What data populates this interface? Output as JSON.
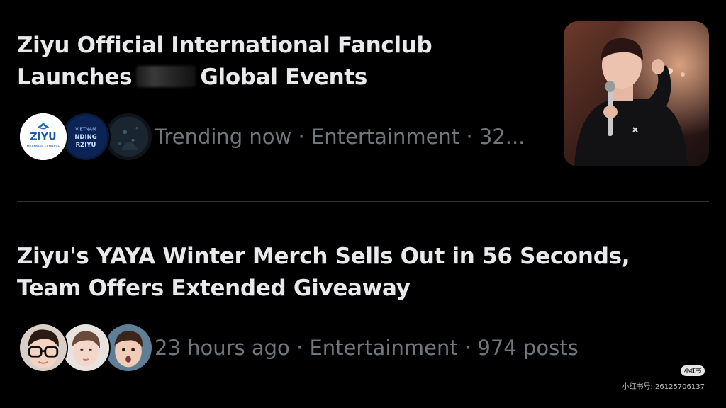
{
  "trends": [
    {
      "headline_part1": "Ziyu Official International Fanclub Launches",
      "headline_part2": "Global Events",
      "meta": "Trending now · Entertainment · 32...",
      "avatars": [
        {
          "icon": "ziyu-myanmar-fanbase-logo",
          "text": "ZIYU",
          "subtext": "MYANMAR FANBASE"
        },
        {
          "icon": "vietnam-fanbase-logo",
          "text": "VIETNAM"
        },
        {
          "icon": "dark-blue-avatar"
        }
      ],
      "thumbnail": "performer-with-microphone-photo"
    },
    {
      "headline": "Ziyu's YAYA Winter Merch Sells Out in 56 Seconds, Team Offers Extended Giveaway",
      "meta": "23 hours ago · Entertainment · 974 posts",
      "avatars": [
        {
          "icon": "person-with-glasses-avatar"
        },
        {
          "icon": "person-portrait-avatar"
        },
        {
          "icon": "person-surprised-avatar"
        }
      ]
    }
  ],
  "watermark": {
    "logo": "小红书",
    "id": "小红书号: 26125706137"
  },
  "colors": {
    "background": "#000000",
    "headline": "#e7e9ea",
    "meta": "#71767b",
    "divider": "#2f3336"
  }
}
